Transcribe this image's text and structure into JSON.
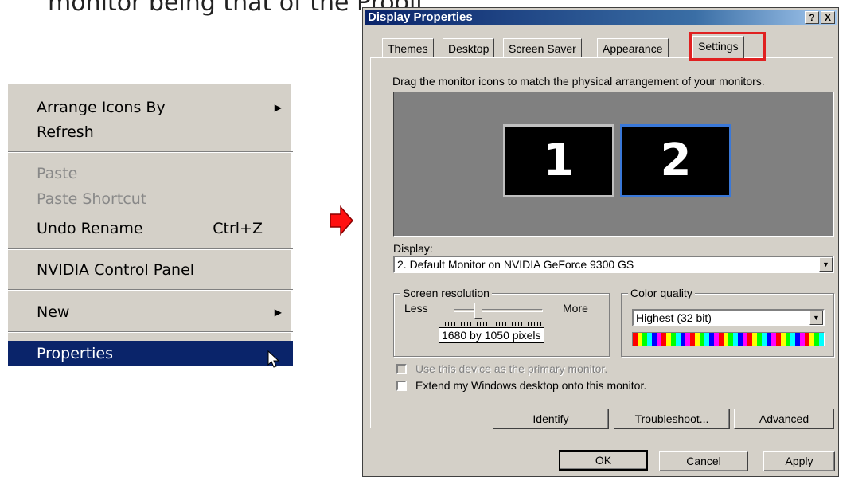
{
  "caption": "monitor being that of the Prooll",
  "context_menu": {
    "items": [
      {
        "label": "Arrange Icons By",
        "submenu": true,
        "disabled": false
      },
      {
        "label": "Refresh",
        "submenu": false,
        "disabled": false
      },
      {
        "label": "Paste",
        "submenu": false,
        "disabled": true
      },
      {
        "label": "Paste Shortcut",
        "submenu": false,
        "disabled": true
      },
      {
        "label": "Undo Rename",
        "shortcut": "Ctrl+Z",
        "submenu": false,
        "disabled": false
      },
      {
        "label": "NVIDIA Control Panel",
        "submenu": false,
        "disabled": false
      },
      {
        "label": "New",
        "submenu": true,
        "disabled": false
      },
      {
        "label": "Properties",
        "submenu": false,
        "disabled": false,
        "selected": true
      }
    ]
  },
  "dialog": {
    "title": "Display Properties",
    "help_button": "?",
    "close_button": "X",
    "tabs": [
      "Themes",
      "Desktop",
      "Screen Saver",
      "Appearance",
      "Settings"
    ],
    "active_tab": "Settings",
    "instruction": "Drag the monitor icons to match the physical arrangement of your monitors.",
    "monitors": [
      "1",
      "2"
    ],
    "selected_monitor": "2",
    "display_label": "Display:",
    "display_value": "2. Default Monitor on NVIDIA GeForce 9300 GS",
    "resolution": {
      "group_title": "Screen resolution",
      "less_label": "Less",
      "more_label": "More",
      "value": "1680 by 1050 pixels",
      "slider_position": 0.3
    },
    "color_quality": {
      "group_title": "Color quality",
      "value": "Highest (32 bit)"
    },
    "primary_monitor_label": "Use this device as the primary monitor.",
    "extend_desktop_label": "Extend my Windows desktop onto this monitor.",
    "buttons": {
      "identify": "Identify",
      "troubleshoot": "Troubleshoot...",
      "advanced": "Advanced",
      "ok": "OK",
      "cancel": "Cancel",
      "apply": "Apply"
    },
    "colors": {
      "titlebar": "#0a246a",
      "face": "#d4d0c8",
      "highlight_box": "#e02020",
      "menu_selection": "#0a246a"
    }
  }
}
